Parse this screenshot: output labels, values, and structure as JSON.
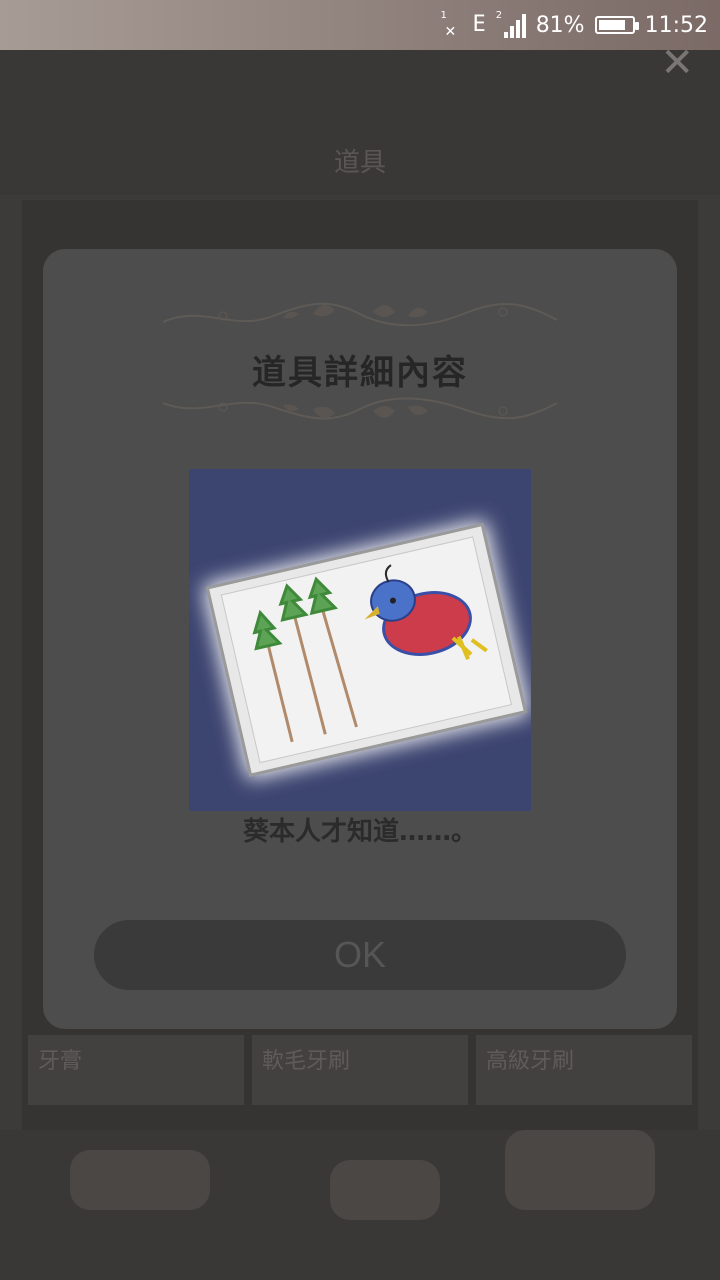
{
  "status_bar": {
    "network": "E",
    "sim1": "1",
    "sim2": "2",
    "battery_percent": "81%",
    "battery_level": 0.81,
    "time": "11:52"
  },
  "background": {
    "header_title": "道具",
    "close_icon": "close-icon",
    "grid_items": [
      "牙膏",
      "軟毛牙刷",
      "高級牙刷"
    ]
  },
  "modal": {
    "title": "道具詳細內容",
    "description": "葵本人才知道……。",
    "ok_label": "OK",
    "item_icon": "jigsaw-puzzle-bird-drawing"
  }
}
